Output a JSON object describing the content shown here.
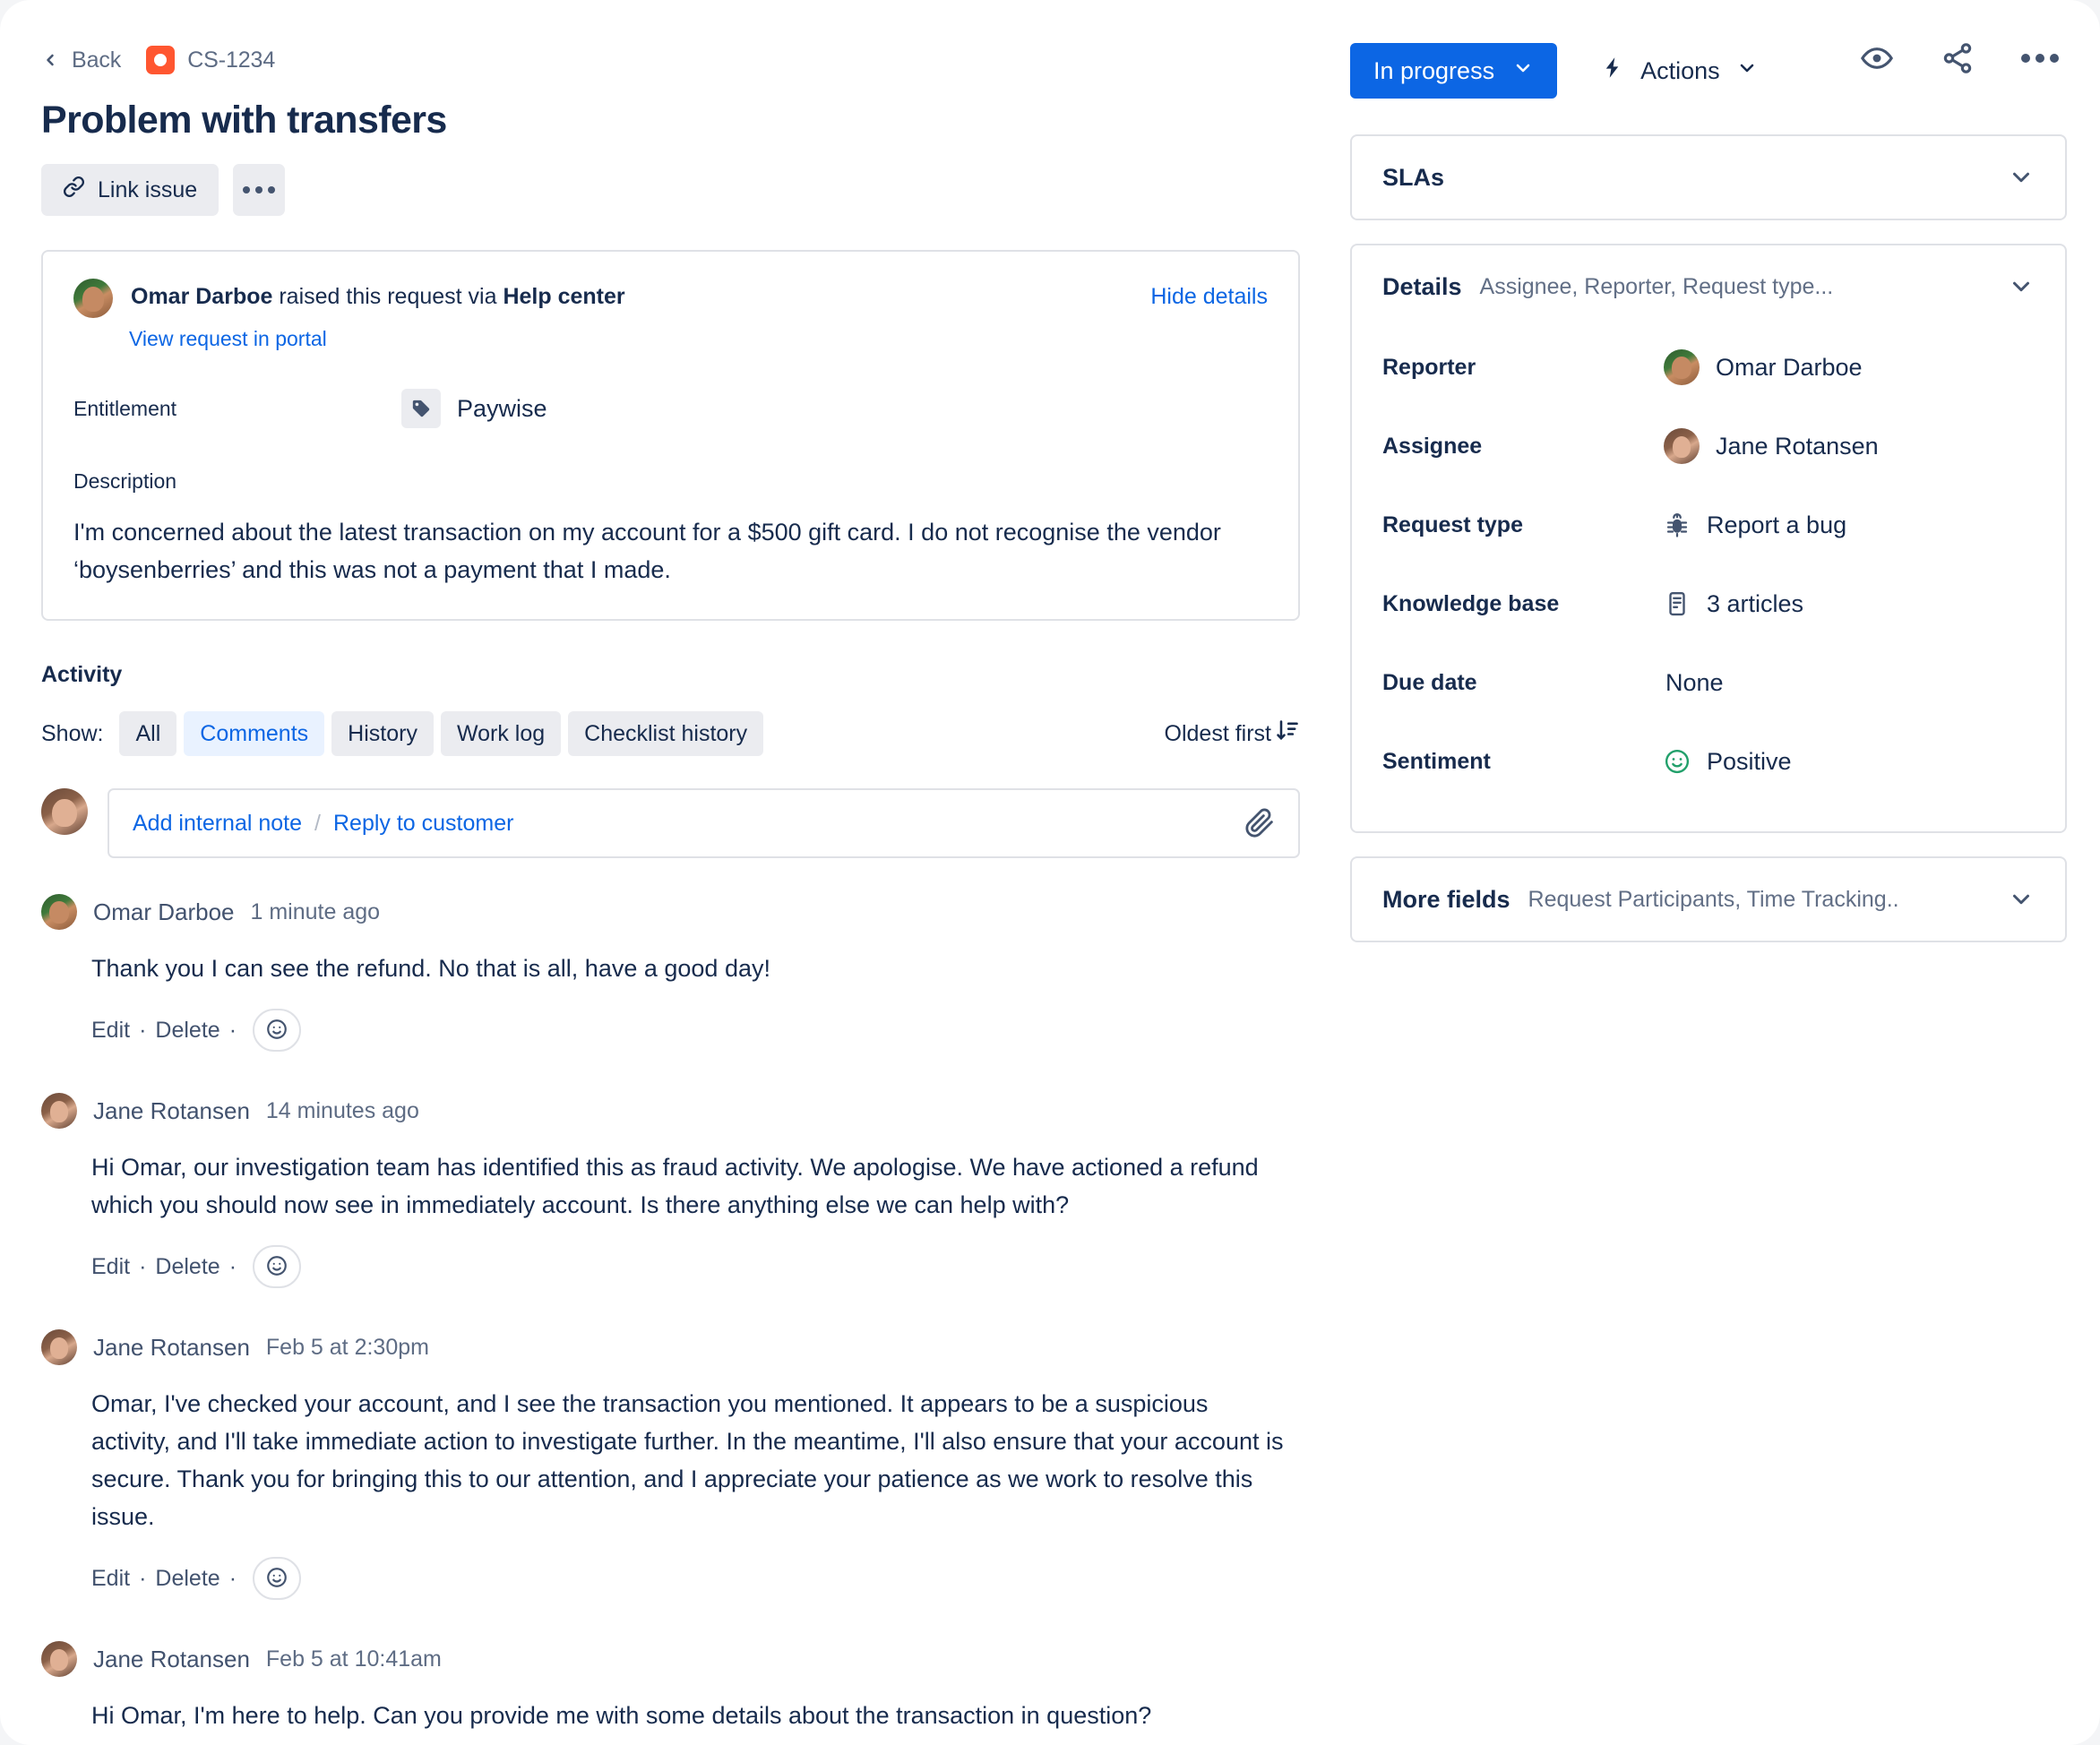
{
  "header": {
    "back_label": "Back",
    "issue_key": "CS-1234",
    "title": "Problem with transfers",
    "link_issue_label": "Link issue",
    "watch_icon": "eye-icon",
    "share_icon": "share-icon",
    "more_icon": "more-options-icon"
  },
  "status": {
    "label": "In progress",
    "color": "#0c66e4",
    "actions_label": "Actions"
  },
  "request": {
    "raiser": "Omar Darboe",
    "raised_middle": " raised this request via ",
    "channel": "Help center",
    "hide_details_label": "Hide details",
    "portal_link_label": "View request in portal",
    "entitlement_label": "Entitlement",
    "entitlement_value": "Paywise",
    "description_label": "Description",
    "description": "I'm concerned about the latest transaction on my account for a $500 gift card. I do not recognise the vendor ‘boysenberries’ and this was not a payment that I made."
  },
  "activity": {
    "heading": "Activity",
    "show_label": "Show:",
    "filters": [
      {
        "label": "All",
        "selected": false
      },
      {
        "label": "Comments",
        "selected": true
      },
      {
        "label": "History",
        "selected": false
      },
      {
        "label": "Work log",
        "selected": false
      },
      {
        "label": "Checklist history",
        "selected": false
      }
    ],
    "sort_label": "Oldest first",
    "composer": {
      "internal_note_label": "Add internal note",
      "divider": "/",
      "reply_label": "Reply to customer",
      "attach_icon": "paperclip-icon"
    },
    "comment_actions": {
      "edit": "Edit",
      "delete": "Delete",
      "separator": "·"
    },
    "comments": [
      {
        "author": "Omar Darboe",
        "avatar": "omar",
        "time": "1 minute ago",
        "body": "Thank you I can see the refund. No that is all, have a good day!",
        "has_actions": true
      },
      {
        "author": "Jane Rotansen",
        "avatar": "jane",
        "time": "14 minutes ago",
        "body": "Hi Omar, our investigation team has identified this as fraud activity. We apologise. We have actioned a refund which you should now see in immediately account. Is there anything else we can help with?",
        "has_actions": true
      },
      {
        "author": "Jane Rotansen",
        "avatar": "jane",
        "time": "Feb 5 at 2:30pm",
        "body": "Omar, I've checked your account, and I see the transaction you mentioned. It appears to be a suspicious activity, and I'll take immediate action to investigate further. In the meantime, I'll also ensure that your account is secure. Thank you for bringing this to our attention, and I appreciate your patience as we work to resolve this issue.",
        "has_actions": true
      },
      {
        "author": "Jane Rotansen",
        "avatar": "jane",
        "time": "Feb 5 at 10:41am",
        "body": "Hi Omar, I'm here to help. Can you provide me with some details about the transaction in question?",
        "has_actions": false
      }
    ]
  },
  "sidebar": {
    "slas": {
      "title": "SLAs"
    },
    "details": {
      "title": "Details",
      "subtitle": "Assignee, Reporter, Request type...",
      "fields": [
        {
          "label": "Reporter",
          "value": "Omar Darboe",
          "icon": "avatar-omar"
        },
        {
          "label": "Assignee",
          "value": "Jane Rotansen",
          "icon": "avatar-jane"
        },
        {
          "label": "Request type",
          "value": "Report a bug",
          "icon": "bug-icon"
        },
        {
          "label": "Knowledge base",
          "value": "3 articles",
          "icon": "article-icon"
        },
        {
          "label": "Due date",
          "value": "None",
          "icon": "none"
        },
        {
          "label": "Sentiment",
          "value": "Positive",
          "icon": "smiley-green-icon"
        }
      ]
    },
    "more_fields": {
      "title": "More fields",
      "subtitle": "Request Participants, Time Tracking.."
    }
  }
}
